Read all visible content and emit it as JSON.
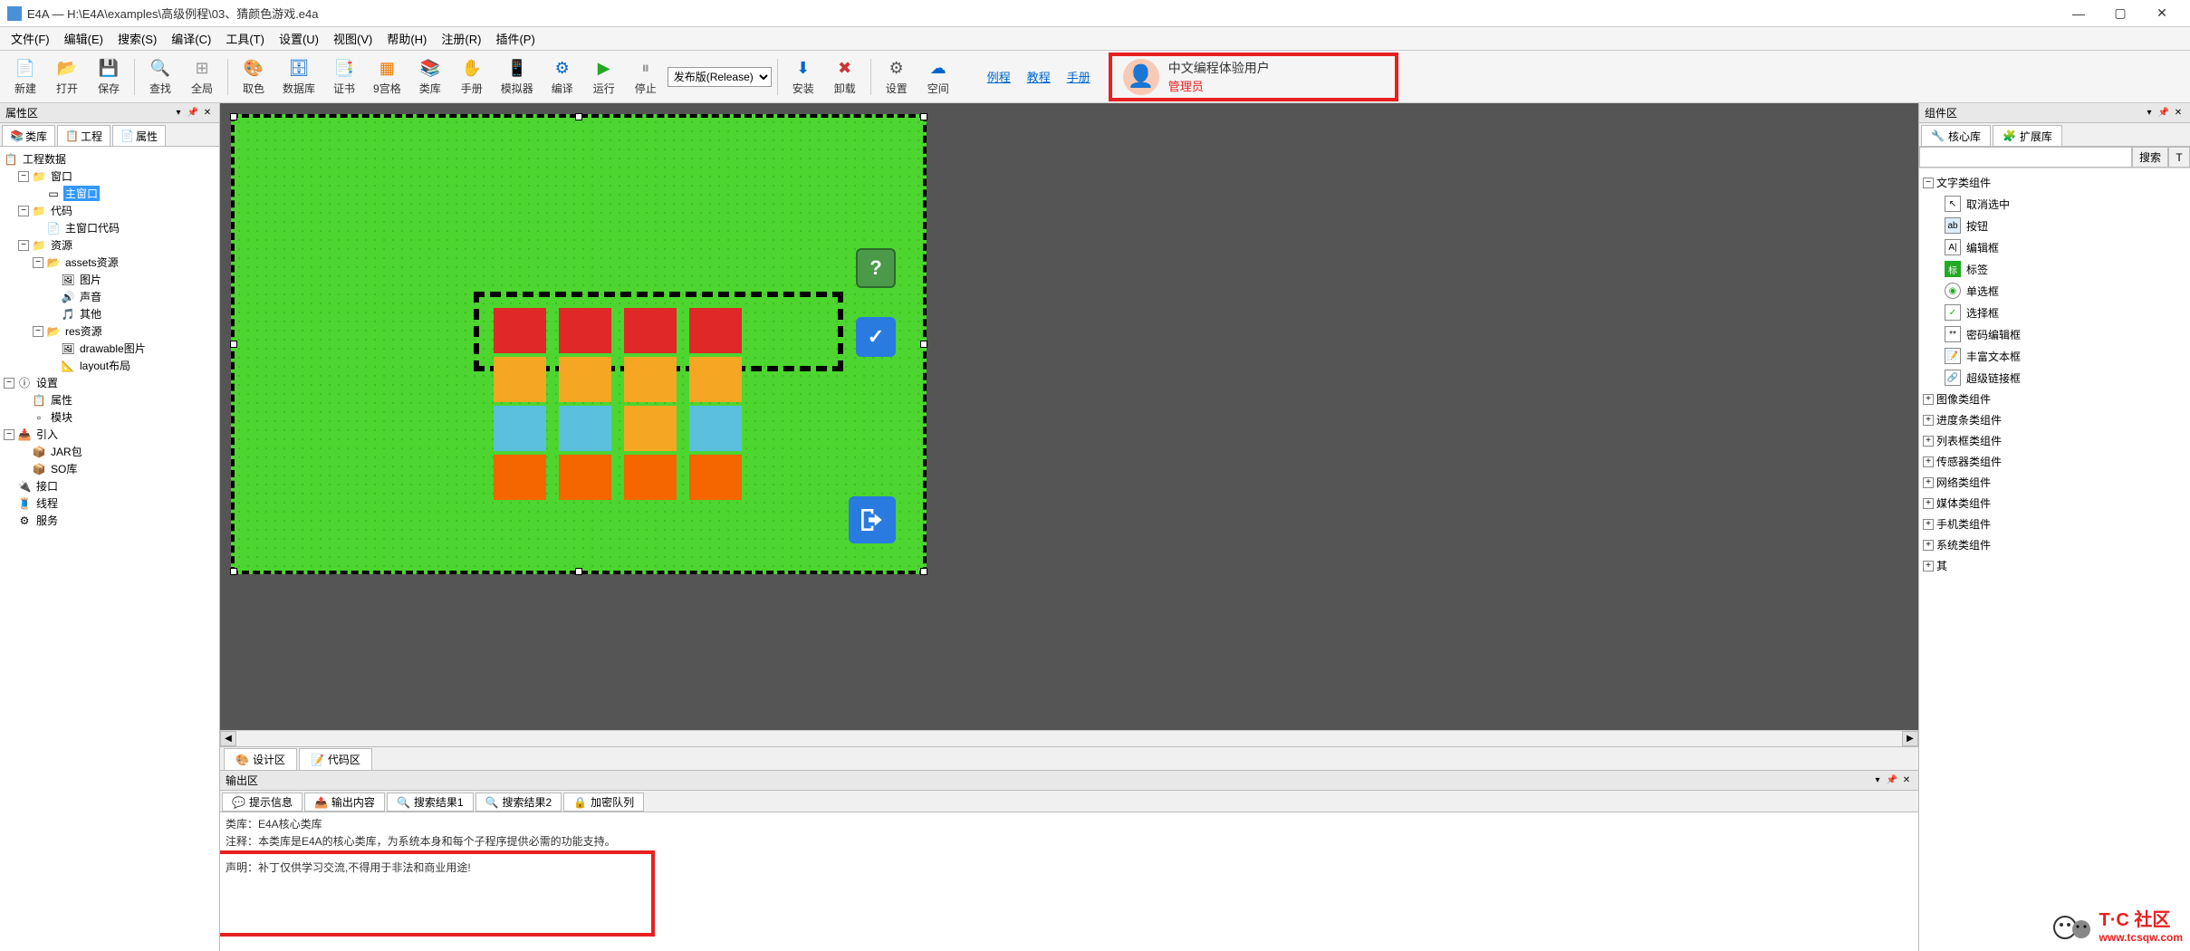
{
  "window": {
    "title": "E4A — H:\\E4A\\examples\\高级例程\\03、猜颜色游戏.e4a"
  },
  "menu": [
    "文件(F)",
    "编辑(E)",
    "搜索(S)",
    "编译(C)",
    "工具(T)",
    "设置(U)",
    "视图(V)",
    "帮助(H)",
    "注册(R)",
    "插件(P)"
  ],
  "toolbar": {
    "new": "新建",
    "open": "打开",
    "save": "保存",
    "find": "查找",
    "full": "全局",
    "color": "取色",
    "db": "数据库",
    "cert": "证书",
    "grid": "9宫格",
    "lib": "类库",
    "man": "手册",
    "sim": "模拟器",
    "compile": "编译",
    "run": "运行",
    "stop": "停止",
    "release": "发布版(Release)",
    "install": "安装",
    "uninstall": "卸载",
    "settings": "设置",
    "space": "空间",
    "link_example": "例程",
    "link_tutorial": "教程",
    "link_manual": "手册"
  },
  "user": {
    "name": "中文编程体验用户",
    "role": "管理员"
  },
  "left_panel": {
    "title": "属性区",
    "tabs": {
      "lib": "类库",
      "proj": "工程",
      "prop": "属性"
    },
    "tree": {
      "root": "工程数据",
      "window": "窗口",
      "main_window": "主窗口",
      "code": "代码",
      "main_window_code": "主窗口代码",
      "res": "资源",
      "assets": "assets资源",
      "img": "图片",
      "sound": "声音",
      "other": "其他",
      "resres": "res资源",
      "drawable": "drawable图片",
      "layout": "layout布局",
      "settings": "设置",
      "prop": "属性",
      "module": "模块",
      "import": "引入",
      "jar": "JAR包",
      "so": "SO库",
      "interface": "接口",
      "thread": "线程",
      "service": "服务"
    }
  },
  "center": {
    "tabs": {
      "design": "设计区",
      "code": "代码区"
    }
  },
  "output": {
    "title": "输出区",
    "tabs": {
      "info": "提示信息",
      "out": "输出内容",
      "s1": "搜索结果1",
      "s2": "搜索结果2",
      "enc": "加密队列"
    },
    "line1": "类库：E4A核心类库",
    "line2": "注释：本类库是E4A的核心类库，为系统本身和每个子程序提供必需的功能支持。",
    "line3": "声明：补丁仅供学习交流,不得用于非法和商业用途!"
  },
  "right_panel": {
    "title": "组件区",
    "tabs": {
      "core": "核心库",
      "ext": "扩展库"
    },
    "search_btn": "搜索",
    "cats": {
      "text": "文字类组件",
      "deselect": "取消选中",
      "button": "按钮",
      "edit": "编辑框",
      "label": "标签",
      "radio": "单选框",
      "check": "选择框",
      "pwd": "密码编辑框",
      "rich": "丰富文本框",
      "link": "超级链接框",
      "image": "图像类组件",
      "progress": "进度条类组件",
      "list": "列表框类组件",
      "sensor": "传感器类组件",
      "net": "网络类组件",
      "media": "媒体类组件",
      "phone": "手机类组件",
      "sys": "系统类组件",
      "other": "其"
    }
  },
  "watermark": {
    "brand": "T·C 社区",
    "url": "www.tcsqw.com"
  }
}
